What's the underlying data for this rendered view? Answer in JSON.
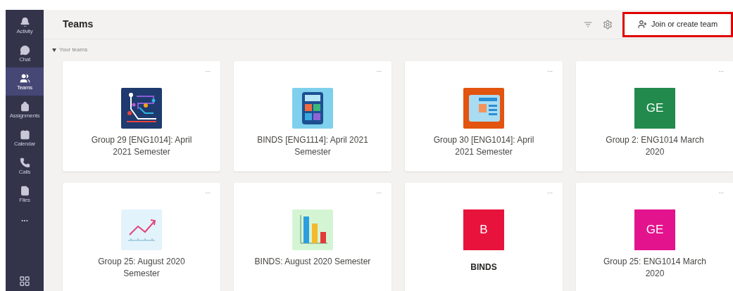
{
  "sidebar": {
    "items": [
      {
        "label": "Activity",
        "selected": false
      },
      {
        "label": "Chat",
        "selected": false
      },
      {
        "label": "Teams",
        "selected": true
      },
      {
        "label": "Assignments",
        "selected": false
      },
      {
        "label": "Calendar",
        "selected": false
      },
      {
        "label": "Calls",
        "selected": false
      },
      {
        "label": "Files",
        "selected": false
      }
    ],
    "more": "..."
  },
  "header": {
    "title": "Teams",
    "join_button": {
      "label": "Join or create team",
      "highlighted": true
    }
  },
  "section": {
    "label": "Your teams",
    "expanded": true
  },
  "teams": [
    {
      "name": "Group 29 [ENG1014]: April 2021 Semester",
      "kind": "circuit",
      "bold": false,
      "more": "..."
    },
    {
      "name": "BINDS [ENG1114]: April 2021 Semester",
      "kind": "calculator",
      "bold": false,
      "more": "..."
    },
    {
      "name": "Group 30 [ENG1014]: April 2021 Semester",
      "kind": "newspaper",
      "bold": false,
      "more": "..."
    },
    {
      "name": "Group 2: ENG1014 March 2020",
      "kind": "initials",
      "initials": "GE",
      "color": "#218a4c",
      "bold": false,
      "more": "..."
    },
    {
      "name": "Group 25: August 2020 Semester",
      "kind": "trend",
      "bold": false,
      "more": "..."
    },
    {
      "name": "BINDS: August 2020 Semester",
      "kind": "bars",
      "bold": false,
      "more": "..."
    },
    {
      "name": "BINDS",
      "kind": "initials",
      "initials": "B",
      "color": "#e8133d",
      "bold": true,
      "more": "..."
    },
    {
      "name": "Group 25: ENG1014 March 2020",
      "kind": "initials",
      "initials": "GE",
      "color": "#e3138d",
      "bold": false,
      "more": "..."
    }
  ]
}
